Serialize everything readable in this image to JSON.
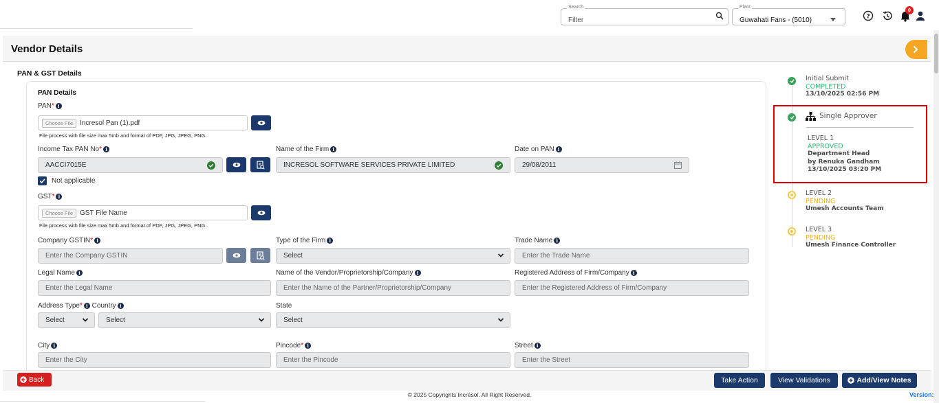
{
  "topbar": {
    "search_legend": "Search",
    "search_placeholder": "Filter",
    "plant_legend": "Plant",
    "plant_value": "Guwahati Fans - (5010)",
    "notification_count": "0"
  },
  "page": {
    "title": "Vendor Details",
    "section_title": "PAN & GST Details",
    "pan_details_title": "PAN Details"
  },
  "pan": {
    "pan_label": "PAN",
    "choose_file": "Choose File",
    "pan_file_name": "Incresol Pan (1).pdf",
    "hint": "File process with file size max 5mb and format of PDF, JPG, JPEG, PNG.",
    "income_tax_label": "Income Tax PAN No",
    "income_tax_value": "AACCI7015E",
    "firm_name_label": "Name of the Firm",
    "firm_name_value": "INCRESOL SOFTWARE SERVICES PRIVATE LIMITED",
    "date_label": "Date on PAN",
    "date_value": "29/08/2011",
    "not_applicable": "Not applicable"
  },
  "gst": {
    "gst_label": "GST",
    "choose_file": "Choose File",
    "gst_file_name": "GST File Name",
    "hint": "File process with file size max 5mb and format of PDF, JPG, JPEG, PNG.",
    "gstin_label": "Company GSTIN",
    "gstin_placeholder": "Enter the Company GSTIN",
    "firm_type_label": "Type of the Firm",
    "firm_type_value": "Select",
    "trade_name_label": "Trade Name",
    "trade_name_placeholder": "Enter the Trade Name",
    "legal_name_label": "Legal Name",
    "legal_name_placeholder": "Enter the Legal Name",
    "vendor_name_label": "Name of the Vendor/Proprietorship/Company",
    "vendor_name_placeholder": "Enter the Name of the Partner/Proprietorship/Company",
    "reg_address_label": "Registered Address of Firm/Company",
    "reg_address_placeholder": "Enter the Registered Address of Firm/Company",
    "address_type_label": "Address Type",
    "country_label": "Country",
    "address_type_value": "Select",
    "country_value": "Select",
    "state_label": "State",
    "state_value": "Select",
    "city_label": "City",
    "city_placeholder": "Enter the City",
    "pincode_label": "Pincode",
    "pincode_placeholder": "Enter the Pincode",
    "street_label": "Street",
    "street_placeholder": "Enter the Street"
  },
  "timeline": [
    {
      "title": "Initial Submit",
      "status": "COMPLETED",
      "by": "",
      "date": "13/10/2025 02:56 PM"
    },
    {
      "title": "Single Approver",
      "level": "LEVEL 1",
      "status": "APPROVED",
      "role": "Department Head",
      "by": "by Renuka Gandham",
      "date": "13/10/2025 03:20 PM"
    },
    {
      "level": "LEVEL 2",
      "status": "PENDING",
      "by": "Umesh Accounts Team"
    },
    {
      "level": "LEVEL 3",
      "status": "PENDING",
      "by": "Umesh Finance Controller"
    }
  ],
  "actions": {
    "back": "Back",
    "take_action": "Take Action",
    "view_validations": "View Validations",
    "add_view_notes": "Add/View Notes"
  },
  "footer": {
    "copyright": "© 2025 Copyrights Incresol. All Right Reserved.",
    "version": "Version:"
  },
  "colors": {
    "navy": "#1b3a6b",
    "approved_green": "#2dbb6f",
    "pending_yellow": "#f0b323",
    "back_red": "#d61f1f",
    "accent_orange": "#f5a623"
  }
}
